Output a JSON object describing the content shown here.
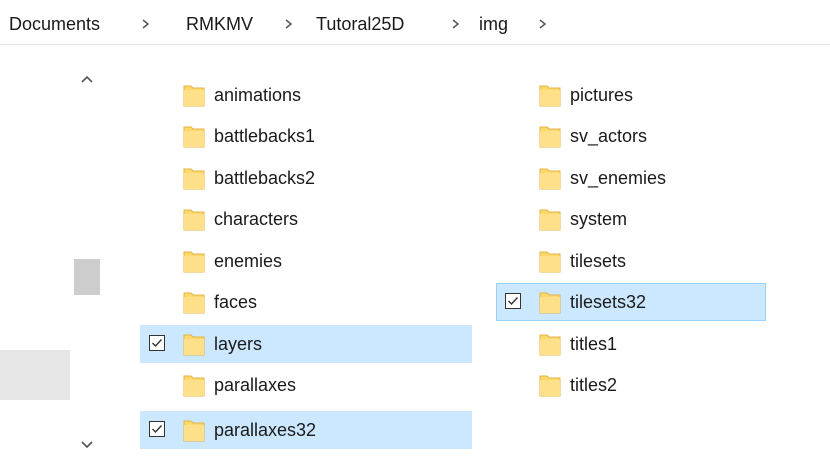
{
  "breadcrumb": {
    "items": [
      "Documents",
      "RMKMV",
      "Tutoral25D",
      "img"
    ]
  },
  "colors": {
    "selection_fill": "#cce8ff",
    "selection_border": "#99d1ff",
    "folder_yellow": "#ffd86b",
    "scroll_thumb": "#cdcdcd"
  },
  "icons": {
    "folder": "folder-icon",
    "scroll_up": "chevron-up-icon",
    "scroll_down": "chevron-down-icon",
    "breadcrumb_separator": "chevron-right-icon",
    "checkbox": "checkbox-checked-icon"
  },
  "columns": [
    {
      "items": [
        {
          "name": "animations",
          "selected": false
        },
        {
          "name": "battlebacks1",
          "selected": false
        },
        {
          "name": "battlebacks2",
          "selected": false
        },
        {
          "name": "characters",
          "selected": false
        },
        {
          "name": "enemies",
          "selected": false
        },
        {
          "name": "faces",
          "selected": false
        },
        {
          "name": "layers",
          "selected": true
        },
        {
          "name": "parallaxes",
          "selected": false
        },
        {
          "name": "parallaxes32",
          "selected": true
        }
      ]
    },
    {
      "items": [
        {
          "name": "pictures",
          "selected": false
        },
        {
          "name": "sv_actors",
          "selected": false
        },
        {
          "name": "sv_enemies",
          "selected": false
        },
        {
          "name": "system",
          "selected": false
        },
        {
          "name": "tilesets",
          "selected": false
        },
        {
          "name": "tilesets32",
          "selected": true
        },
        {
          "name": "titles1",
          "selected": false
        },
        {
          "name": "titles2",
          "selected": false
        }
      ]
    }
  ]
}
